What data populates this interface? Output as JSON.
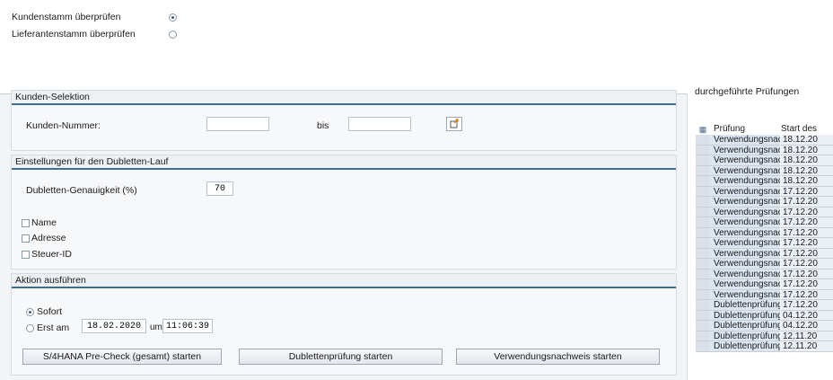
{
  "mode": {
    "options": [
      {
        "label": "Kundenstamm überprüfen",
        "selected": true
      },
      {
        "label": "Lieferantenstamm überprüfen",
        "selected": false
      }
    ]
  },
  "kunden_selektion": {
    "title": "Kunden-Selektion",
    "kunden_nummer_label": "Kunden-Nummer:",
    "from_value": "",
    "bis_label": "bis",
    "to_value": ""
  },
  "einstellungen": {
    "title": "Einstellungen für den Dubletten-Lauf",
    "genauigkeit_label": "Dubletten-Genauigkeit (%)",
    "genauigkeit_value": "70",
    "checkboxes": [
      {
        "label": "Name",
        "checked": false
      },
      {
        "label": "Adresse",
        "checked": false
      },
      {
        "label": "Steuer-ID",
        "checked": false
      }
    ]
  },
  "aktion": {
    "title": "Aktion ausführen",
    "sofort_label": "Sofort",
    "sofort_selected": true,
    "erst_am_label": "Erst am",
    "date_value": "18.02.2020",
    "um_label": "um",
    "time_value": "11:06:39",
    "buttons": {
      "precheck": "S/4HANA Pre-Check (gesamt) starten",
      "dubletten": "Dublettenprüfung starten",
      "verwendung": "Verwendungsnachweis starten"
    }
  },
  "pruefungen": {
    "title": "durchgeführte Prüfungen",
    "columns": [
      "Prüfung",
      "Start des"
    ],
    "rows": [
      [
        "Verwendungsnachweis",
        "18.12.20"
      ],
      [
        "Verwendungsnachweis",
        "18.12.20"
      ],
      [
        "Verwendungsnachweis",
        "18.12.20"
      ],
      [
        "Verwendungsnachweis",
        "18.12.20"
      ],
      [
        "Verwendungsnachweis",
        "18.12.20"
      ],
      [
        "Verwendungsnachweis",
        "17.12.20"
      ],
      [
        "Verwendungsnachweis",
        "17.12.20"
      ],
      [
        "Verwendungsnachweis",
        "17.12.20"
      ],
      [
        "Verwendungsnachweis",
        "17.12.20"
      ],
      [
        "Verwendungsnachweis",
        "17.12.20"
      ],
      [
        "Verwendungsnachweis",
        "17.12.20"
      ],
      [
        "Verwendungsnachweis",
        "17.12.20"
      ],
      [
        "Verwendungsnachweis",
        "17.12.20"
      ],
      [
        "Verwendungsnachweis",
        "17.12.20"
      ],
      [
        "Verwendungsnachweis",
        "17.12.20"
      ],
      [
        "Verwendungsnachweis",
        "17.12.20"
      ],
      [
        "Dublettenprüfung",
        "17.12.20"
      ],
      [
        "Dublettenprüfung",
        "04.12.20"
      ],
      [
        "Dublettenprüfung",
        "04.12.20"
      ],
      [
        "Dublettenprüfung",
        "12.11.20"
      ],
      [
        "Dublettenprüfung",
        "12.11.20"
      ]
    ]
  },
  "icons": {
    "value_help": "select-icon",
    "table_settings": "table-settings-icon"
  },
  "colors": {
    "section_line": "#3e6d96",
    "row_highlight": "#dce6f1"
  }
}
